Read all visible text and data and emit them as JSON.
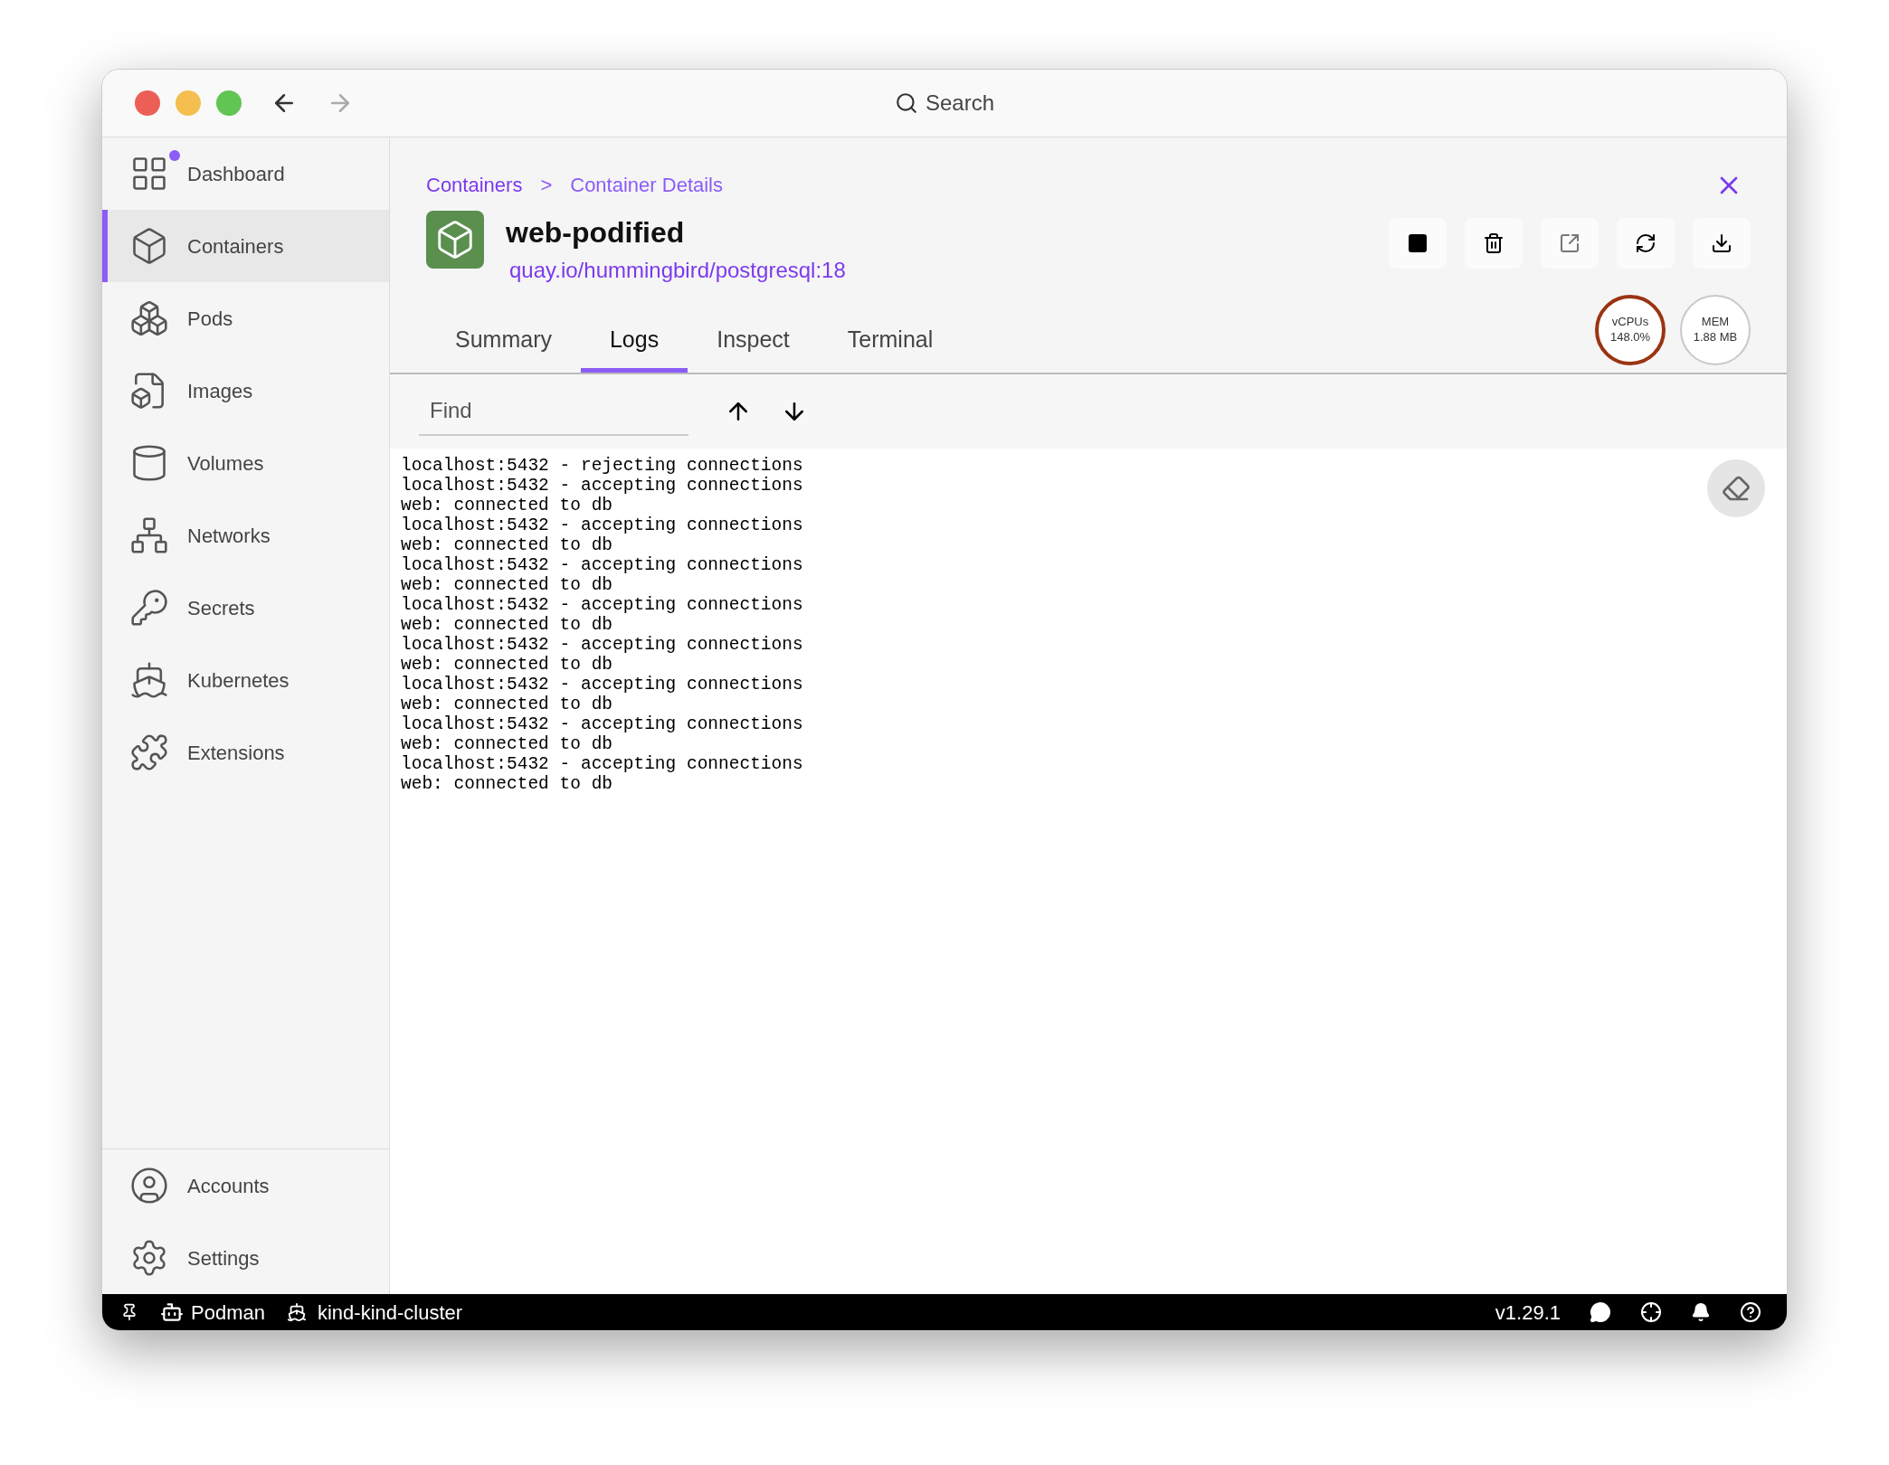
{
  "titlebar": {
    "search_placeholder": "Search"
  },
  "sidebar": {
    "items": [
      {
        "label": "Dashboard",
        "selected": false,
        "notification": true
      },
      {
        "label": "Containers",
        "selected": true,
        "notification": false
      },
      {
        "label": "Pods",
        "selected": false,
        "notification": false
      },
      {
        "label": "Images",
        "selected": false,
        "notification": false
      },
      {
        "label": "Volumes",
        "selected": false,
        "notification": false
      },
      {
        "label": "Networks",
        "selected": false,
        "notification": false
      },
      {
        "label": "Secrets",
        "selected": false,
        "notification": false
      },
      {
        "label": "Kubernetes",
        "selected": false,
        "notification": false
      },
      {
        "label": "Extensions",
        "selected": false,
        "notification": false
      }
    ],
    "bottom_items": [
      {
        "label": "Accounts",
        "selected": false
      },
      {
        "label": "Settings",
        "selected": false
      }
    ]
  },
  "breadcrumb": {
    "parent": "Containers",
    "separator": ">",
    "current": "Container Details"
  },
  "container": {
    "name": "web-podified",
    "image": "quay.io/hummingbird/postgresql:18"
  },
  "gauges": [
    {
      "label": "vCPUs",
      "value": "148.0%",
      "color": "#9a3412"
    },
    {
      "label": "MEM",
      "value": "1.88 MB",
      "color": "#c8c8c8"
    }
  ],
  "tabs": [
    {
      "label": "Summary",
      "selected": false
    },
    {
      "label": "Logs",
      "selected": true
    },
    {
      "label": "Inspect",
      "selected": false
    },
    {
      "label": "Terminal",
      "selected": false
    }
  ],
  "find": {
    "placeholder": "Find"
  },
  "log_lines": [
    "localhost:5432 - rejecting connections",
    "localhost:5432 - accepting connections",
    "web: connected to db",
    "localhost:5432 - accepting connections",
    "web: connected to db",
    "localhost:5432 - accepting connections",
    "web: connected to db",
    "localhost:5432 - accepting connections",
    "web: connected to db",
    "localhost:5432 - accepting connections",
    "web: connected to db",
    "localhost:5432 - accepting connections",
    "web: connected to db",
    "localhost:5432 - accepting connections",
    "web: connected to db",
    "localhost:5432 - accepting connections",
    "web: connected to db"
  ],
  "status_bar": {
    "engine": "Podman",
    "cluster": "kind-kind-cluster",
    "version": "v1.29.1"
  }
}
